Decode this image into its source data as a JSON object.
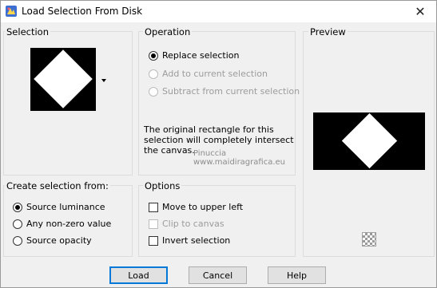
{
  "window": {
    "title": "Load Selection From Disk"
  },
  "selection": {
    "label": "Selection"
  },
  "operation": {
    "label": "Operation",
    "options": [
      "Replace selection",
      "Add to current selection",
      "Subtract from current selection"
    ],
    "selected_index": 0
  },
  "note": "The original rectangle for this selection will completely intersect the canvas.",
  "preview": {
    "label": "Preview"
  },
  "create_from": {
    "label": "Create selection from:",
    "options": [
      "Source luminance",
      "Any non-zero value",
      "Source opacity"
    ],
    "selected_index": 0
  },
  "options": {
    "label": "Options",
    "items": [
      {
        "label": "Move to upper left",
        "checked": false,
        "enabled": true
      },
      {
        "label": "Clip to canvas",
        "checked": false,
        "enabled": false
      },
      {
        "label": "Invert selection",
        "checked": false,
        "enabled": true
      }
    ]
  },
  "watermark": {
    "line1": "Pinuccia",
    "line2": "www.maidiragrafica.eu"
  },
  "buttons": {
    "load": "Load",
    "cancel": "Cancel",
    "help": "Help"
  }
}
